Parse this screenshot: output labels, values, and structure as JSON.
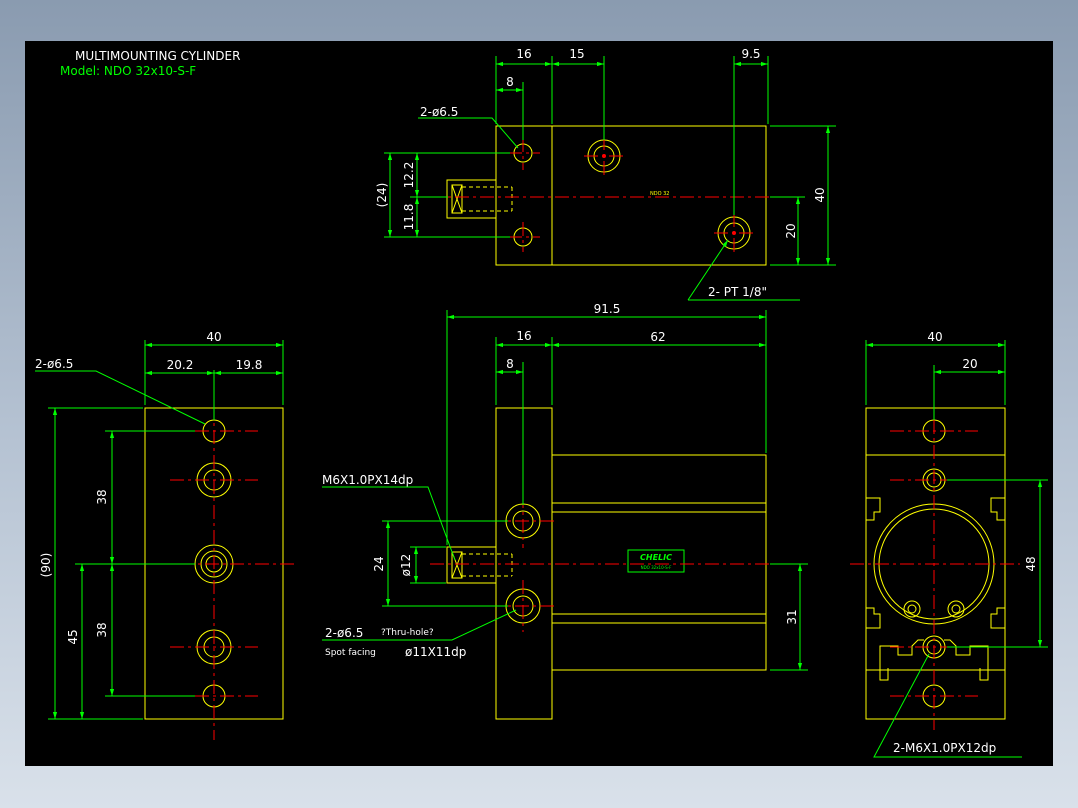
{
  "title_block": {
    "title": "MULTIMOUNTING CYLINDER",
    "model": "Model:  NDO 32x10-S-F"
  },
  "top_view": {
    "dims": {
      "d16": "16",
      "d15": "15",
      "d9_5": "9.5",
      "d8": "8",
      "d12_2": "12.2",
      "d24": "(24)",
      "d11_8": "11.8",
      "d40": "40",
      "d20": "20"
    },
    "callouts": {
      "holes": "2-ø6.5",
      "port": "2- PT 1/8\""
    },
    "marking": "NDO 32"
  },
  "left_view": {
    "dims": {
      "d40": "40",
      "d20_2": "20.2",
      "d19_8": "19.8",
      "d90": "(90)",
      "d38a": "38",
      "d38b": "38",
      "d45": "45"
    },
    "callouts": {
      "holes": "2-ø6.5"
    }
  },
  "front_view": {
    "dims": {
      "d91_5": "91.5",
      "d16": "16",
      "d62": "62",
      "d8": "8",
      "d24": "24",
      "d12": "ø12",
      "d31": "31"
    },
    "callouts": {
      "thread": "M6X1.0PX14dp",
      "holes_a": "2-ø6.5",
      "holes_b": "?Thru-hole?",
      "spot_a": "Spot facing",
      "spot_b": "ø11X11dp"
    },
    "logo": "CHELIC",
    "logo_sub": "NDO 32x10-S-F"
  },
  "right_view": {
    "dims": {
      "d40": "40",
      "d20": "20",
      "d48": "48"
    },
    "callouts": {
      "thread": "2-M6X1.0PX12dp"
    }
  },
  "colors": {
    "background": "#000000",
    "outline": "#ffff00",
    "dimension": "#00ff00",
    "text": "#ffffff",
    "centerline": "#ff0000"
  }
}
